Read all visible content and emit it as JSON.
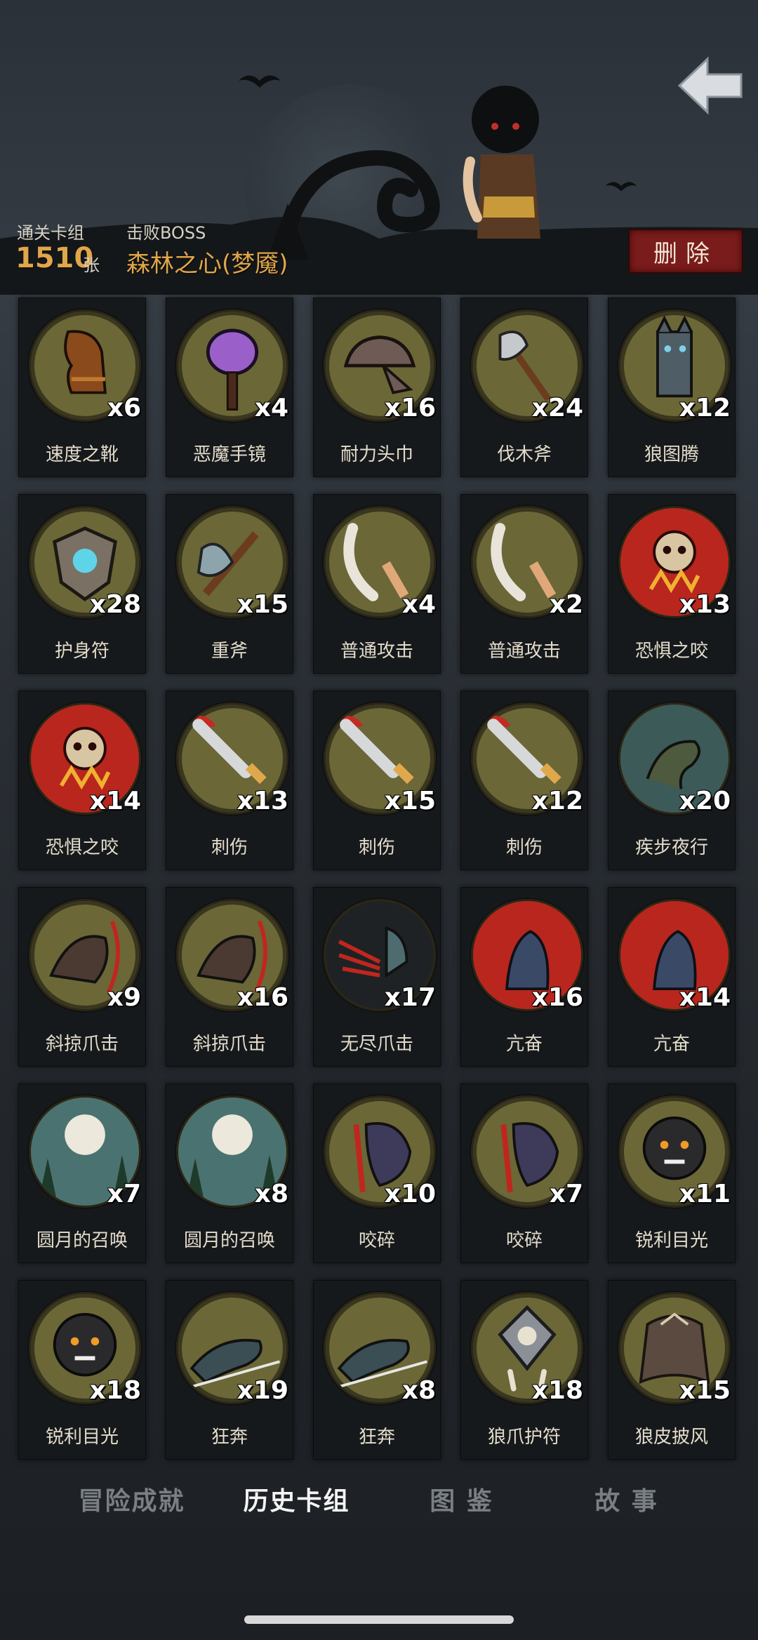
{
  "header": {
    "cleared_decks_label": "通关卡组",
    "cleared_decks_value": "1510",
    "cleared_decks_unit": "张",
    "boss_label": "击败BOSS",
    "boss_name": "森林之心(梦魇)",
    "delete_label": "删除"
  },
  "cards": [
    {
      "name": "速度之靴",
      "count": "x6",
      "icon": "boot-icon"
    },
    {
      "name": "恶魔手镜",
      "count": "x4",
      "icon": "mirror-icon"
    },
    {
      "name": "耐力头巾",
      "count": "x16",
      "icon": "bandana-icon"
    },
    {
      "name": "伐木斧",
      "count": "x24",
      "icon": "axe-icon"
    },
    {
      "name": "狼图腾",
      "count": "x12",
      "icon": "wolf-totem-icon"
    },
    {
      "name": "护身符",
      "count": "x28",
      "icon": "shield-amulet-icon"
    },
    {
      "name": "重斧",
      "count": "x15",
      "icon": "heavy-axe-icon"
    },
    {
      "name": "普通攻击",
      "count": "x4",
      "icon": "slash-icon"
    },
    {
      "name": "普通攻击",
      "count": "x2",
      "icon": "slash-icon"
    },
    {
      "name": "恐惧之咬",
      "count": "x13",
      "icon": "skull-bite-icon"
    },
    {
      "name": "恐惧之咬",
      "count": "x14",
      "icon": "skull-bite-icon"
    },
    {
      "name": "刺伤",
      "count": "x13",
      "icon": "dagger-icon"
    },
    {
      "name": "刺伤",
      "count": "x15",
      "icon": "dagger-icon"
    },
    {
      "name": "刺伤",
      "count": "x12",
      "icon": "dagger-icon"
    },
    {
      "name": "疾步夜行",
      "count": "x20",
      "icon": "werewolf-run-icon"
    },
    {
      "name": "斜掠爪击",
      "count": "x9",
      "icon": "claw-strike-icon"
    },
    {
      "name": "斜掠爪击",
      "count": "x16",
      "icon": "claw-strike-icon"
    },
    {
      "name": "无尽爪击",
      "count": "x17",
      "icon": "endless-claw-icon"
    },
    {
      "name": "亢奋",
      "count": "x16",
      "icon": "frenzy-icon"
    },
    {
      "name": "亢奋",
      "count": "x14",
      "icon": "frenzy-icon"
    },
    {
      "name": "圆月的召唤",
      "count": "x7",
      "icon": "full-moon-icon"
    },
    {
      "name": "圆月的召唤",
      "count": "x8",
      "icon": "full-moon-icon"
    },
    {
      "name": "咬碎",
      "count": "x10",
      "icon": "crush-bite-icon"
    },
    {
      "name": "咬碎",
      "count": "x7",
      "icon": "crush-bite-icon"
    },
    {
      "name": "锐利目光",
      "count": "x11",
      "icon": "sharp-eye-icon"
    },
    {
      "name": "锐利目光",
      "count": "x18",
      "icon": "sharp-eye-icon"
    },
    {
      "name": "狂奔",
      "count": "x19",
      "icon": "wolf-dash-icon"
    },
    {
      "name": "狂奔",
      "count": "x8",
      "icon": "wolf-dash-icon"
    },
    {
      "name": "狼爪护符",
      "count": "x18",
      "icon": "claw-amulet-icon"
    },
    {
      "name": "狼皮披风",
      "count": "x15",
      "icon": "wolf-cloak-icon"
    }
  ],
  "tabs": [
    {
      "label": "冒险成就",
      "active": false
    },
    {
      "label": "历史卡组",
      "active": true
    },
    {
      "label": "图 鉴",
      "active": false
    },
    {
      "label": "故 事",
      "active": false
    }
  ]
}
